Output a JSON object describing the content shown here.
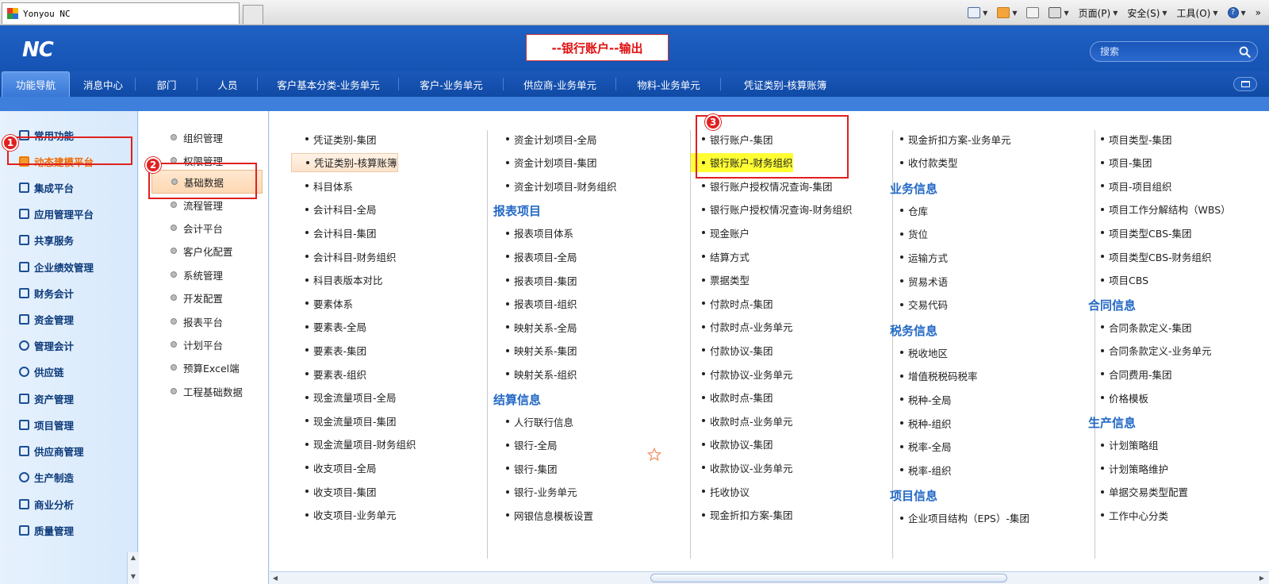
{
  "browser": {
    "tab_title": "Yonyou NC",
    "tools": {
      "page_label": "页面(P)",
      "safety_label": "安全(S)",
      "tools_label": "工具(O)",
      "help_glyph": "?",
      "more_glyph": "»"
    }
  },
  "header": {
    "logo": "NC",
    "title": "--银行账户--输出",
    "search_placeholder": "搜索"
  },
  "top_nav": {
    "tabs": [
      {
        "label": "功能导航",
        "active": true
      },
      {
        "label": "消息中心"
      },
      {
        "label": "部门"
      },
      {
        "label": "人员"
      },
      {
        "label": "客户基本分类-业务单元"
      },
      {
        "label": "客户-业务单元"
      },
      {
        "label": "供应商-业务单元"
      },
      {
        "label": "物料-业务单元"
      },
      {
        "label": "凭证类别-核算账簿"
      }
    ]
  },
  "sidebar": {
    "items": [
      {
        "label": "常用功能",
        "icon": "monitor-icon"
      },
      {
        "label": "动态建模平台",
        "icon": "cube-icon",
        "active": true
      },
      {
        "label": "集成平台",
        "icon": "network-icon"
      },
      {
        "label": "应用管理平台",
        "icon": "app-grid-icon"
      },
      {
        "label": "共享服务",
        "icon": "share-icon"
      },
      {
        "label": "企业绩效管理",
        "icon": "performance-icon"
      },
      {
        "label": "财务会计",
        "icon": "finance-icon"
      },
      {
        "label": "资金管理",
        "icon": "yen-icon"
      },
      {
        "label": "管理会计",
        "icon": "gauge-icon"
      },
      {
        "label": "供应链",
        "icon": "chain-icon"
      },
      {
        "label": "资产管理",
        "icon": "asset-icon"
      },
      {
        "label": "项目管理",
        "icon": "project-icon"
      },
      {
        "label": "供应商管理",
        "icon": "supplier-icon"
      },
      {
        "label": "生产制造",
        "icon": "gear-icon"
      },
      {
        "label": "商业分析",
        "icon": "analysis-icon"
      },
      {
        "label": "质量管理",
        "icon": "quality-icon"
      }
    ]
  },
  "middle": {
    "items": [
      {
        "label": "组织管理"
      },
      {
        "label": "权限管理"
      },
      {
        "label": "基础数据",
        "active": true
      },
      {
        "label": "流程管理"
      },
      {
        "label": "会计平台"
      },
      {
        "label": "客户化配置"
      },
      {
        "label": "系统管理"
      },
      {
        "label": "开发配置"
      },
      {
        "label": "报表平台"
      },
      {
        "label": "计划平台"
      },
      {
        "label": "预算Excel端"
      },
      {
        "label": "工程基础数据"
      }
    ]
  },
  "main": {
    "col1": [
      "凭证类别-集团",
      "凭证类别-核算账簿",
      "科目体系",
      "会计科目-全局",
      "会计科目-集团",
      "会计科目-财务组织",
      "科目表版本对比",
      "要素体系",
      "要素表-全局",
      "要素表-集团",
      "要素表-组织",
      "现金流量项目-全局",
      "现金流量项目-集团",
      "现金流量项目-财务组织",
      "收支项目-全局",
      "收支项目-集团",
      "收支项目-业务单元"
    ],
    "col2_top": [
      "资金计划项目-全局",
      "资金计划项目-集团",
      "资金计划项目-财务组织"
    ],
    "col2_head1": "报表项目",
    "col2_mid": [
      "报表项目体系",
      "报表项目-全局",
      "报表项目-集团",
      "报表项目-组织",
      "映射关系-全局",
      "映射关系-集团",
      "映射关系-组织"
    ],
    "col2_head2": "结算信息",
    "col2_bot": [
      "人行联行信息",
      "银行-全局",
      "银行-集团",
      "银行-业务单元",
      "网银信息模板设置"
    ],
    "col3": [
      "银行账户-集团",
      "银行账户-财务组织",
      "银行账户授权情况查询-集团",
      "银行账户授权情况查询-财务组织",
      "现金账户",
      "结算方式",
      "票据类型",
      "付款时点-集团",
      "付款时点-业务单元",
      "付款协议-集团",
      "付款协议-业务单元",
      "收款时点-集团",
      "收款时点-业务单元",
      "收款协议-集团",
      "收款协议-业务单元",
      "托收协议",
      "现金折扣方案-集团"
    ],
    "col4_top": [
      "现金折扣方案-业务单元",
      "收付款类型"
    ],
    "col4_head1": "业务信息",
    "col4_mid": [
      "仓库",
      "货位",
      "运输方式",
      "贸易术语",
      "交易代码"
    ],
    "col4_head2": "税务信息",
    "col4_tax": [
      "税收地区",
      "增值税税码税率",
      "税种-全局",
      "税种-组织",
      "税率-全局",
      "税率-组织"
    ],
    "col4_head3": "项目信息",
    "col4_bot": [
      "企业项目结构（EPS）-集团"
    ],
    "col5_top": [
      "项目类型-集团",
      "项目-集团",
      "项目-项目组织",
      "项目工作分解结构（WBS）",
      "项目类型CBS-集团",
      "项目类型CBS-财务组织",
      "项目CBS"
    ],
    "col5_head1": "合同信息",
    "col5_mid": [
      "合同条款定义-集团",
      "合同条款定义-业务单元",
      "合同费用-集团",
      "价格模板"
    ],
    "col5_head2": "生产信息",
    "col5_bot": [
      "计划策略组",
      "计划策略维护",
      "单据交易类型配置",
      "工作中心分类"
    ]
  },
  "annotations": [
    "1",
    "2",
    "3"
  ],
  "colors": {
    "header_blue": "#1f61c4",
    "accent_orange": "#f06a00",
    "annotation_red": "#e02020",
    "highlight_yellow": "#ffff33",
    "section_head_blue": "#2369c5"
  }
}
